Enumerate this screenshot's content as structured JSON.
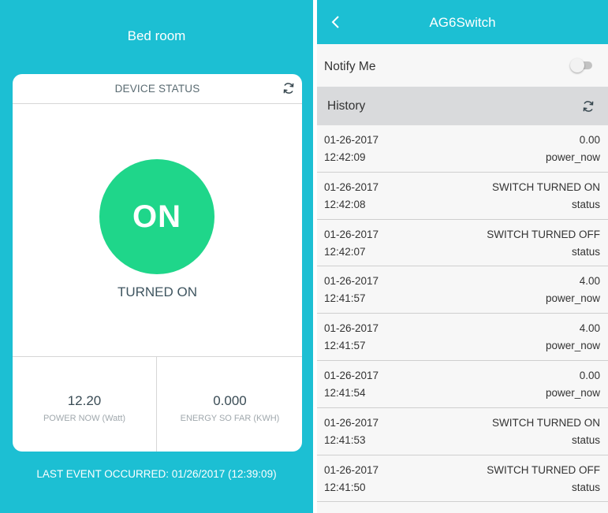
{
  "left": {
    "room_title": "Bed room",
    "card": {
      "header": "DEVICE STATUS",
      "refresh_icon": "refresh-icon",
      "state_label": "ON",
      "state_color": "#1fd68a",
      "status_text": "TURNED ON",
      "power": {
        "value": "12.20",
        "label": "POWER NOW (Watt)"
      },
      "energy": {
        "value": "0.000",
        "label": "ENERGY SO FAR (KWH)"
      }
    },
    "last_event": "LAST EVENT OCCURRED: 01/26/2017 (12:39:09)"
  },
  "right": {
    "title": "AG6Switch",
    "back_icon": "chevron-left-icon",
    "notify": {
      "label": "Notify Me",
      "enabled": false
    },
    "history": {
      "label": "History",
      "refresh_icon": "refresh-icon",
      "rows": [
        {
          "date": "01-26-2017",
          "time": "12:42:09",
          "value": "0.00",
          "key": "power_now"
        },
        {
          "date": "01-26-2017",
          "time": "12:42:08",
          "value": "SWITCH TURNED ON",
          "key": "status"
        },
        {
          "date": "01-26-2017",
          "time": "12:42:07",
          "value": "SWITCH TURNED OFF",
          "key": "status"
        },
        {
          "date": "01-26-2017",
          "time": "12:41:57",
          "value": "4.00",
          "key": "power_now"
        },
        {
          "date": "01-26-2017",
          "time": "12:41:57",
          "value": "4.00",
          "key": "power_now"
        },
        {
          "date": "01-26-2017",
          "time": "12:41:54",
          "value": "0.00",
          "key": "power_now"
        },
        {
          "date": "01-26-2017",
          "time": "12:41:53",
          "value": "SWITCH TURNED ON",
          "key": "status"
        },
        {
          "date": "01-26-2017",
          "time": "12:41:50",
          "value": "SWITCH TURNED OFF",
          "key": "status"
        }
      ]
    }
  },
  "colors": {
    "accent": "#1cbfd3",
    "on_green": "#1fd68a",
    "history_bar": "#d9dadc"
  }
}
